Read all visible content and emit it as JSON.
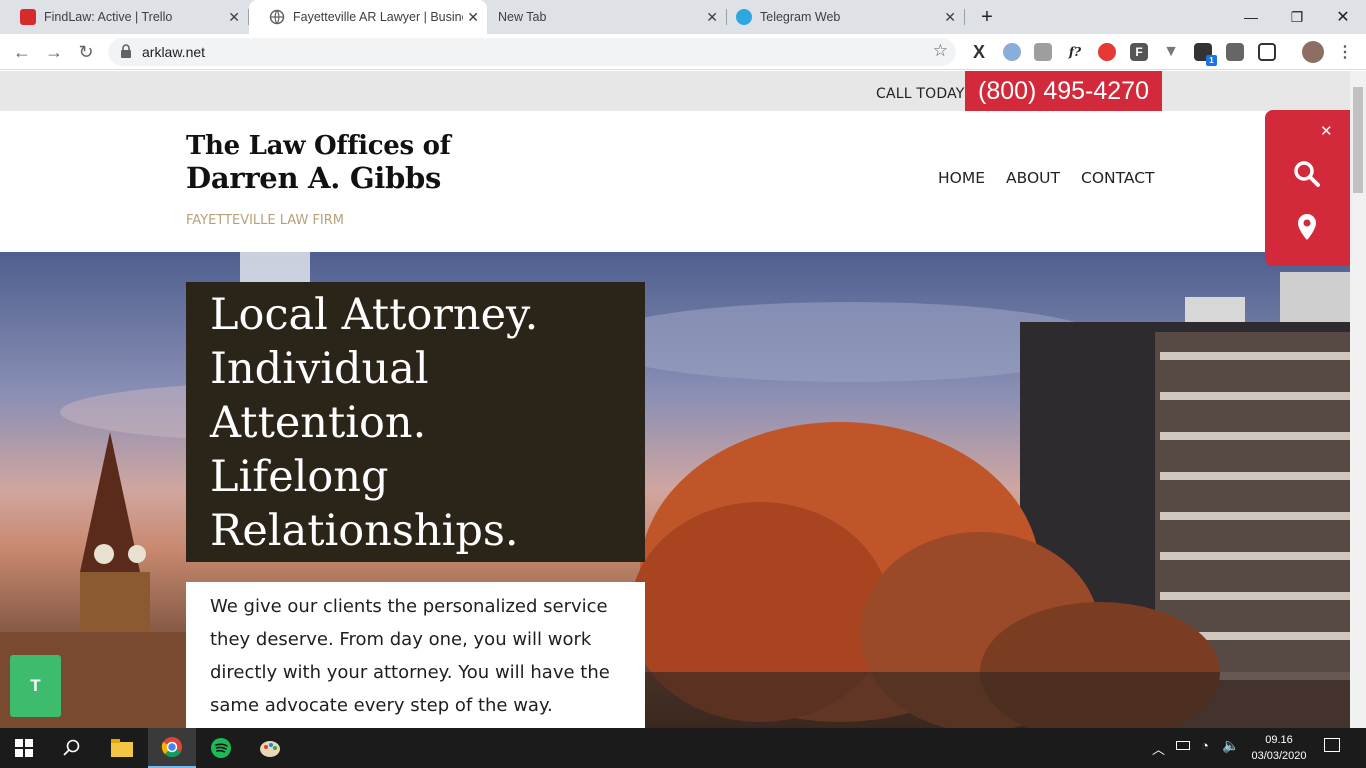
{
  "browser": {
    "tabs": [
      {
        "title": "FindLaw: Active | Trello",
        "icon": "trello-icon"
      },
      {
        "title": "Fayetteville AR Lawyer | Business",
        "icon": "globe-icon"
      },
      {
        "title": "New Tab",
        "icon": ""
      },
      {
        "title": "Telegram Web",
        "icon": "telegram-icon"
      }
    ],
    "url": "arklaw.net",
    "extension_badge": "1"
  },
  "site": {
    "call_label": "CALL TODAY",
    "phone": "(800) 495-4270",
    "logo_line1": "The Law Offices of",
    "logo_line2": "Darren A. Gibbs",
    "tagline": "FAYETTEVILLE LAW FIRM",
    "nav": [
      "HOME",
      "ABOUT",
      "CONTACT"
    ],
    "headline_lines": [
      "Local Attorney.",
      "Individual",
      "Attention.",
      "Lifelong",
      "Relationships."
    ],
    "intro": "We give our clients the personalized service they deserve. From day one, you will work directly with your attorney. You will have the same advocate every step of the way.",
    "badge_letter": "T",
    "accent": "#d32a3b"
  },
  "taskbar": {
    "time": "09.16",
    "date": "03/03/2020"
  }
}
